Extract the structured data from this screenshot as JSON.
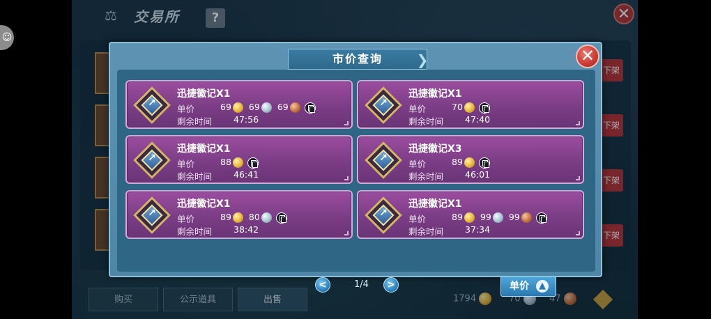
{
  "background": {
    "title": "交易所",
    "help_label": "?",
    "offshelf_label": "下架",
    "tabs": [
      "购买",
      "公示道具",
      "出售"
    ],
    "currency": {
      "gold": "1794",
      "silver": "70",
      "bronze": "47"
    }
  },
  "modal": {
    "title": "市价查询",
    "close_label": "✕",
    "price_label": "单价",
    "time_label": "剩余时间",
    "pagination": {
      "text": "1/4",
      "prev": "<",
      "next": ">"
    },
    "sort_label": "单价",
    "listings": [
      {
        "name": "迅捷徽记X1",
        "prices": [
          {
            "value": "69",
            "coin": "gold"
          },
          {
            "value": "69",
            "coin": "silver"
          },
          {
            "value": "69",
            "coin": "bronze"
          }
        ],
        "time": "47:56"
      },
      {
        "name": "迅捷徽记X1",
        "prices": [
          {
            "value": "70",
            "coin": "gold"
          }
        ],
        "time": "47:40"
      },
      {
        "name": "迅捷徽记X1",
        "prices": [
          {
            "value": "88",
            "coin": "gold"
          }
        ],
        "time": "46:41"
      },
      {
        "name": "迅捷徽记X3",
        "prices": [
          {
            "value": "89",
            "coin": "gold"
          }
        ],
        "time": "46:01"
      },
      {
        "name": "迅捷徽记X1",
        "prices": [
          {
            "value": "89",
            "coin": "gold"
          },
          {
            "value": "80",
            "coin": "silver"
          }
        ],
        "time": "38:42"
      },
      {
        "name": "迅捷徽记X1",
        "prices": [
          {
            "value": "89",
            "coin": "gold"
          },
          {
            "value": "99",
            "coin": "silver"
          },
          {
            "value": "99",
            "coin": "bronze"
          }
        ],
        "time": "37:34"
      }
    ]
  },
  "icons": {
    "item": "swift-emblem-icon",
    "copy": "copy-icon",
    "coins": [
      "gold-coin-icon",
      "silver-coin-icon",
      "bronze-coin-icon"
    ],
    "sort_arrow": "arrow-up-icon"
  },
  "colors": {
    "card_purple": "#7b3d86",
    "modal_blue": "#4e86a7",
    "close_red": "#c93a33",
    "gold": "#e7b73a"
  }
}
